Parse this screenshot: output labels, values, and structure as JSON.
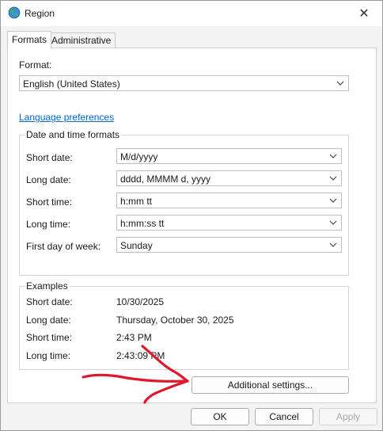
{
  "window": {
    "title": "Region",
    "close_glyph": "✕"
  },
  "tabs": [
    {
      "label": "Formats",
      "active": true
    },
    {
      "label": "Administrative",
      "active": false
    }
  ],
  "format": {
    "label": "Format:",
    "value": "English (United States)"
  },
  "language_link": "Language preferences",
  "datetime": {
    "title": "Date and time formats",
    "rows": [
      {
        "label": "Short date:",
        "value": "M/d/yyyy"
      },
      {
        "label": "Long date:",
        "value": "dddd, MMMM d, yyyy"
      },
      {
        "label": "Short time:",
        "value": "h:mm tt"
      },
      {
        "label": "Long time:",
        "value": "h:mm:ss tt"
      },
      {
        "label": "First day of week:",
        "value": "Sunday"
      }
    ]
  },
  "examples": {
    "title": "Examples",
    "rows": [
      {
        "label": "Short date:",
        "value": "10/30/2025"
      },
      {
        "label": "Long date:",
        "value": "Thursday, October 30, 2025"
      },
      {
        "label": "Short time:",
        "value": "2:43 PM"
      },
      {
        "label": "Long time:",
        "value": "2:43:09 PM"
      }
    ]
  },
  "additional_settings": "Additional settings...",
  "buttons": {
    "ok": "OK",
    "cancel": "Cancel",
    "apply": "Apply"
  },
  "colors": {
    "link": "#0066cc",
    "annotation": "#e0182d"
  },
  "icons": {
    "title": "globe-icon",
    "close": "close-icon",
    "dropdown": "chevron-down-icon"
  }
}
